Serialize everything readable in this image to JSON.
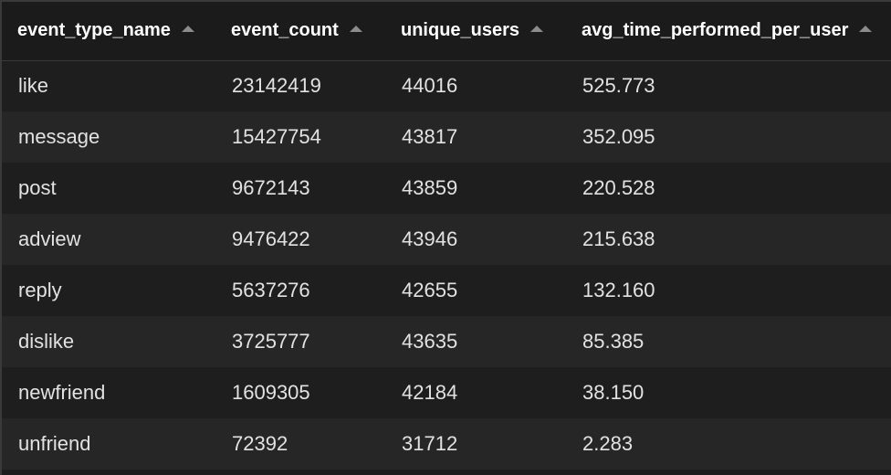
{
  "table": {
    "headers": [
      "event_type_name",
      "event_count",
      "unique_users",
      "avg_time_performed_per_user"
    ],
    "rows": [
      [
        "like",
        "23142419",
        "44016",
        "525.773"
      ],
      [
        "message",
        "15427754",
        "43817",
        "352.095"
      ],
      [
        "post",
        "9672143",
        "43859",
        "220.528"
      ],
      [
        "adview",
        "9476422",
        "43946",
        "215.638"
      ],
      [
        "reply",
        "5637276",
        "42655",
        "132.160"
      ],
      [
        "dislike",
        "3725777",
        "43635",
        "85.385"
      ],
      [
        "newfriend",
        "1609305",
        "42184",
        "38.150"
      ],
      [
        "unfriend",
        "72392",
        "31712",
        "2.283"
      ]
    ]
  }
}
